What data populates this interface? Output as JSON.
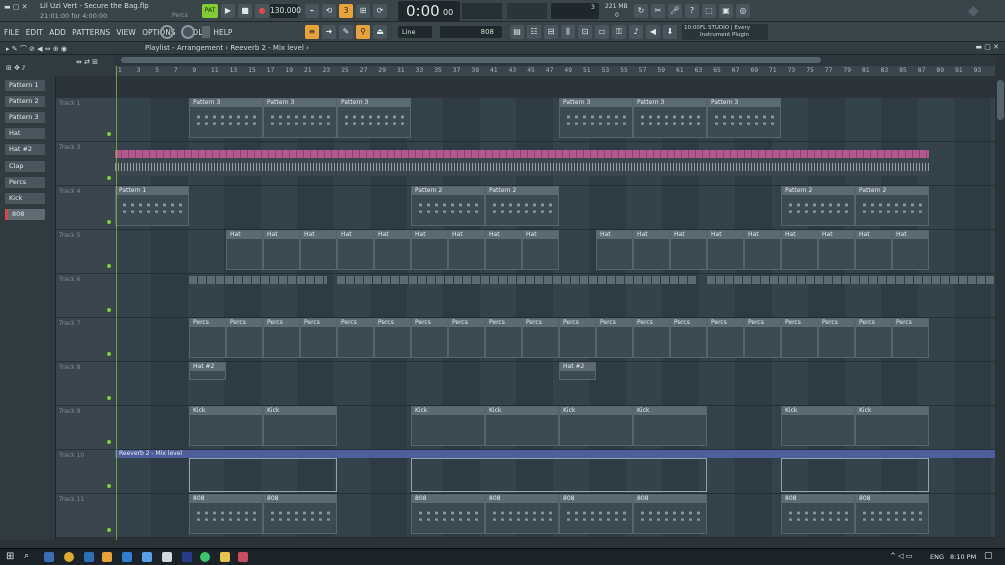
{
  "window": {
    "project_title": "Lil Uzi Vert - Secure the Bag.flp",
    "status_line": "21:01:00 for 4:00:00",
    "percs_hint": "Percs"
  },
  "transport": {
    "mode": "PAT",
    "tempo": "130.000",
    "time": "0:00",
    "time_fraction": "00",
    "cpu_label": "3",
    "memory": "221 MB",
    "memory_sub": "0",
    "pattern_field": "808",
    "snap": "Line",
    "hint_time": "10:00",
    "hint_text": "FL STUDIO | Every Instrument Plugin"
  },
  "menu": [
    "FILE",
    "EDIT",
    "ADD",
    "PATTERNS",
    "VIEW",
    "OPTIONS",
    "TOOLS",
    "HELP"
  ],
  "playlist": {
    "breadcrumb": "Playlist - Arrangement",
    "separator": "›",
    "automation": "Reeverb 2 - Mix level",
    "bar_numbers": [
      "1",
      "3",
      "5",
      "7",
      "9",
      "11",
      "13",
      "15",
      "17",
      "19",
      "21",
      "23",
      "25",
      "27",
      "29",
      "31",
      "33",
      "35",
      "37",
      "39",
      "41",
      "43",
      "45",
      "47",
      "49",
      "51",
      "53",
      "55",
      "57",
      "59",
      "61",
      "63",
      "65",
      "67",
      "69",
      "71",
      "73",
      "75",
      "77",
      "79",
      "81",
      "83",
      "85",
      "87",
      "89",
      "91",
      "93"
    ]
  },
  "picker": [
    "Pattern 1",
    "Pattern 2",
    "Pattern 3",
    "Hat",
    "Hat #2",
    "Clap",
    "Percs",
    "Kick",
    "808"
  ],
  "tracks": [
    {
      "name": "Track 1"
    },
    {
      "name": "Track 3"
    },
    {
      "name": "Track 4"
    },
    {
      "name": "Track 5"
    },
    {
      "name": "Track 6"
    },
    {
      "name": "Track 7"
    },
    {
      "name": "Track 8"
    },
    {
      "name": "Track 9"
    },
    {
      "name": "Track 10"
    },
    {
      "name": "Track 11"
    }
  ],
  "clips": {
    "pattern3": "Pattern 3",
    "pattern1": "Pattern 1",
    "pattern2": "Pattern 2",
    "hat": "Hat",
    "percs": "Percs",
    "hat2": "Hat #2",
    "kick": "Kick",
    "b808": "808",
    "automation": "Reeverb 2 - Mix level"
  },
  "taskbar": {
    "lang": "ENG",
    "clock": "8:10 PM"
  },
  "colors": {
    "accent": "#e8a23a",
    "clip_header": "#5c6a71",
    "audio_clip": "#b05a8c",
    "led_green": "#7fcc33"
  }
}
